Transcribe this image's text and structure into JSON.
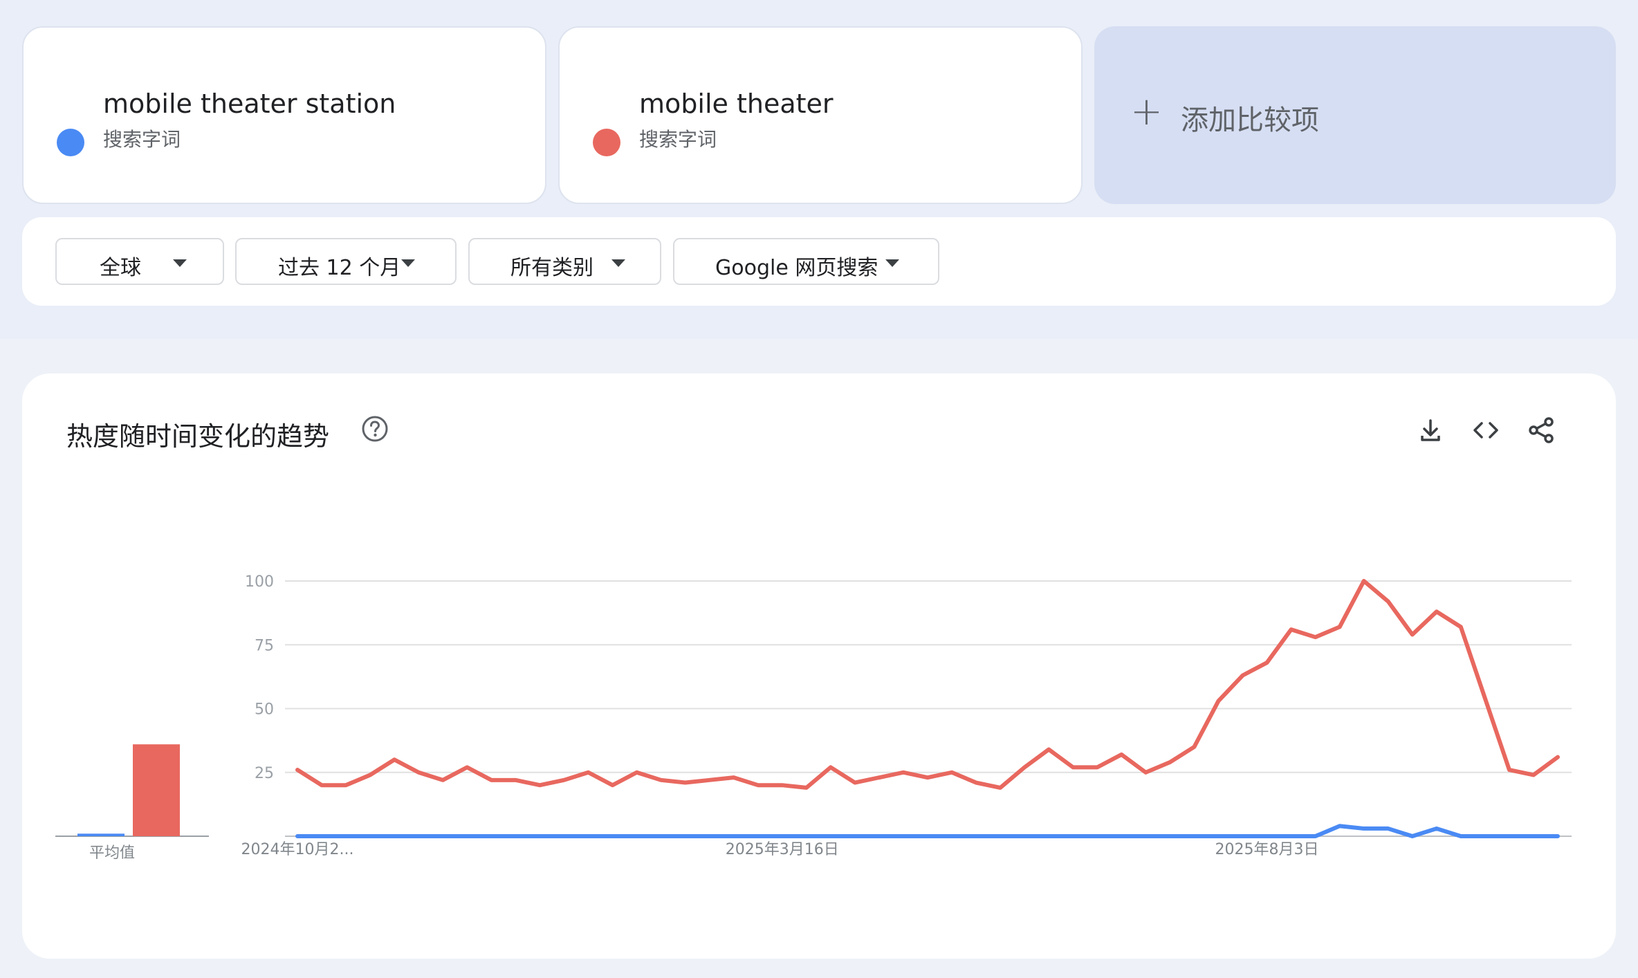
{
  "terms": [
    {
      "name": "mobile theater station",
      "type": "搜索字词",
      "color": "#4a8af4"
    },
    {
      "name": "mobile theater",
      "type": "搜索字词",
      "color": "#e8685f"
    }
  ],
  "add_compare": {
    "plus": "+",
    "label": "添加比较项"
  },
  "filters": [
    {
      "label": "全球"
    },
    {
      "label": "过去 12 个月"
    },
    {
      "label": "所有类别"
    },
    {
      "label": "Google 网页搜索"
    }
  ],
  "chart_section": {
    "title": "热度随时间变化的趋势",
    "help_icon": "help-circle-icon",
    "tools": [
      "download-icon",
      "embed-code-icon",
      "share-icon"
    ]
  },
  "chart_data": {
    "type": "line",
    "y_ticks": [
      "100",
      "75",
      "50",
      "25"
    ],
    "ylim": [
      0,
      100
    ],
    "x_tick_labels": [
      {
        "label": "2024年10月2...",
        "index": 0
      },
      {
        "label": "2025年3月16日",
        "index": 20
      },
      {
        "label": "2025年8月3日",
        "index": 40
      }
    ],
    "series": [
      {
        "name": "mobile theater station",
        "color": "#4a8af4",
        "average": 1,
        "values": [
          0,
          0,
          0,
          0,
          0,
          0,
          0,
          0,
          0,
          0,
          0,
          0,
          0,
          0,
          0,
          0,
          0,
          0,
          0,
          0,
          0,
          0,
          0,
          0,
          0,
          0,
          0,
          0,
          0,
          0,
          0,
          0,
          0,
          0,
          0,
          0,
          0,
          0,
          0,
          0,
          0,
          0,
          0,
          4,
          3,
          3,
          0,
          3,
          0,
          0,
          0,
          0,
          0
        ]
      },
      {
        "name": "mobile theater",
        "color": "#e8685f",
        "average": 36,
        "values": [
          26,
          20,
          20,
          24,
          30,
          25,
          22,
          27,
          22,
          22,
          20,
          22,
          25,
          20,
          25,
          22,
          21,
          22,
          23,
          20,
          20,
          19,
          27,
          21,
          23,
          25,
          23,
          25,
          21,
          19,
          27,
          34,
          27,
          27,
          32,
          25,
          29,
          35,
          53,
          63,
          68,
          81,
          78,
          82,
          100,
          92,
          79,
          88,
          82,
          54,
          26,
          24,
          31
        ]
      }
    ],
    "avg_label": "平均值"
  }
}
